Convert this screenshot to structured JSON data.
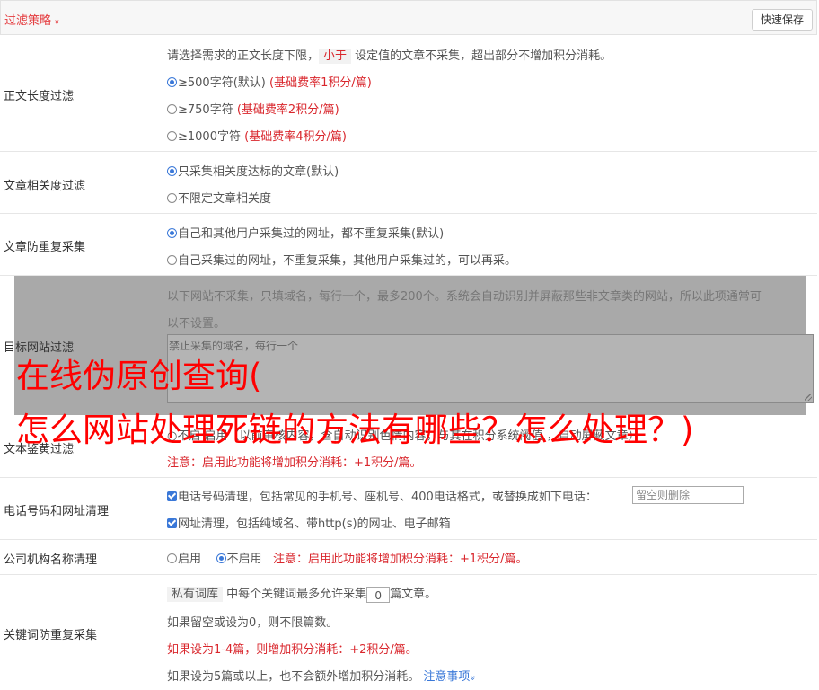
{
  "header": {
    "title": "过滤策略",
    "chevron": "»",
    "save_label": "快速保存"
  },
  "length_filter": {
    "label": "正文长度过滤",
    "desc_a": "请选择需求的正文长度下限，",
    "desc_tag": "小于",
    "desc_b": "设定值的文章不采集，超出部分不增加积分消耗。",
    "options": [
      {
        "text": "≥500字符(默认)",
        "note": "(基础费率1积分/篇)",
        "checked": true
      },
      {
        "text": "≥750字符",
        "note": "(基础费率2积分/篇)",
        "checked": false
      },
      {
        "text": "≥1000字符",
        "note": "(基础费率4积分/篇)",
        "checked": false
      }
    ]
  },
  "relevance_filter": {
    "label": "文章相关度过滤",
    "options": [
      {
        "text": "只采集相关度达标的文章(默认)",
        "checked": true
      },
      {
        "text": "不限定文章相关度",
        "checked": false
      }
    ]
  },
  "dedupe": {
    "label": "文章防重复采集",
    "options": [
      {
        "text": "自己和其他用户采集过的网址，都不重复采集(默认)",
        "checked": true
      },
      {
        "text": "自己采集过的网址，不重复采集，其他用户采集过的，可以再采。",
        "checked": false
      }
    ]
  },
  "target_filter": {
    "label": "目标网站过滤",
    "desc_line1": "以下网站不采集，只填域名，每行一个，最多200个。系统会自动识别并屏蔽那些非文章类的网站，所以此项通常可",
    "desc_line2": "以不设置。",
    "placeholder": "禁止采集的域名，每行一个"
  },
  "text_review": {
    "label": "文本鉴黄过滤",
    "visible_fragment": "○不启   启用（以前审核内容，含自动识别色情内容，与其在积分系统阈值    ，自动屏蔽文章）",
    "note": "注意：启用此功能将增加积分消耗：+1积分/篇。"
  },
  "phone_url": {
    "label": "电话号码和网址清理",
    "phone_text": "电话号码清理，包括常见的手机号、座机号、400电话格式，或替换成如下电话：",
    "phone_placeholder": "留空则删除",
    "url_text": "网址清理，包括纯域名、带http(s)的网址、电子邮箱"
  },
  "company_clean": {
    "label": "公司机构名称清理",
    "opt_on": "启用",
    "opt_off": "不启用",
    "note": "注意：启用此功能将增加积分消耗：+1积分/篇。"
  },
  "keyword_dedupe": {
    "label": "关键词防重复采集",
    "tag": "私有词库",
    "line1_a": "中每个关键词最多允许采集",
    "value": "0",
    "line1_b": "篇文章。",
    "line2": "如果留空或设为0，则不限篇数。",
    "line3": "如果设为1-4篇，则增加积分消耗：+2积分/篇。",
    "line4": "如果设为5篇或以上，也不会额外增加积分消耗。",
    "link": "注意事项",
    "link_chevron": "»"
  },
  "overlay": {
    "line1": "在线伪原创查询(",
    "line2": "怎么网站处理死链的方法有哪些？怎么处理？)"
  }
}
